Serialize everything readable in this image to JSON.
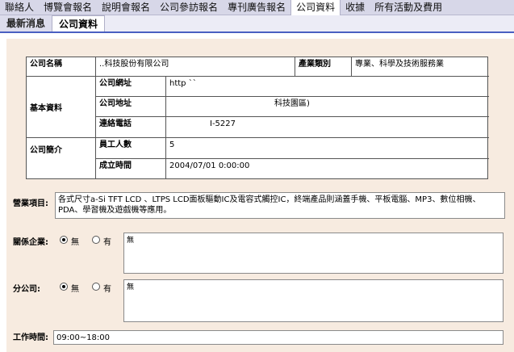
{
  "nav": {
    "items": [
      {
        "label": "聯絡人",
        "active": false
      },
      {
        "label": "博覽會報名",
        "active": false
      },
      {
        "label": "說明會報名",
        "active": false
      },
      {
        "label": "公司參訪報名",
        "active": false
      },
      {
        "label": "專刊廣告報名",
        "active": false
      },
      {
        "label": "公司資料",
        "active": true
      },
      {
        "label": "收據",
        "active": false
      },
      {
        "label": "所有活動及費用",
        "active": false
      }
    ]
  },
  "subtabs": [
    {
      "label": "最新消息",
      "active": false
    },
    {
      "label": "公司資料",
      "active": true
    }
  ],
  "company": {
    "name_label": "公司名稱",
    "name_value": "..科技股份有限公司",
    "industry_label": "產業類別",
    "industry_value": "專業、科學及技術服務業",
    "basic_label": "基本資料",
    "website_label": "公司網址",
    "website_value": "http ``",
    "address_label": "公司地址",
    "address_value": "科技園區)",
    "phone_label": "連絡電話",
    "phone_value": "I-5227",
    "intro_label": "公司簡介",
    "employees_label": "員工人數",
    "employees_value": "5",
    "founded_label": "成立時間",
    "founded_value": "2004/07/01 0:00:00"
  },
  "business": {
    "label": "營業項目:",
    "value": "各式尺寸a-Si TFT LCD 、LTPS LCD面板驅動IC及電容式觸控IC，終端產品則涵蓋手機、平板電腦、MP3、數位相機、PDA、學習機及遊戲機等應用。"
  },
  "affiliate": {
    "label": "關係企業:",
    "opt_no": "無",
    "opt_yes": "有",
    "selected": "無",
    "note": "無"
  },
  "branch": {
    "label": "分公司:",
    "opt_no": "無",
    "opt_yes": "有",
    "selected": "無",
    "note": "無"
  },
  "hours": {
    "label": "工作時間:",
    "value": "09:00~18:00"
  }
}
